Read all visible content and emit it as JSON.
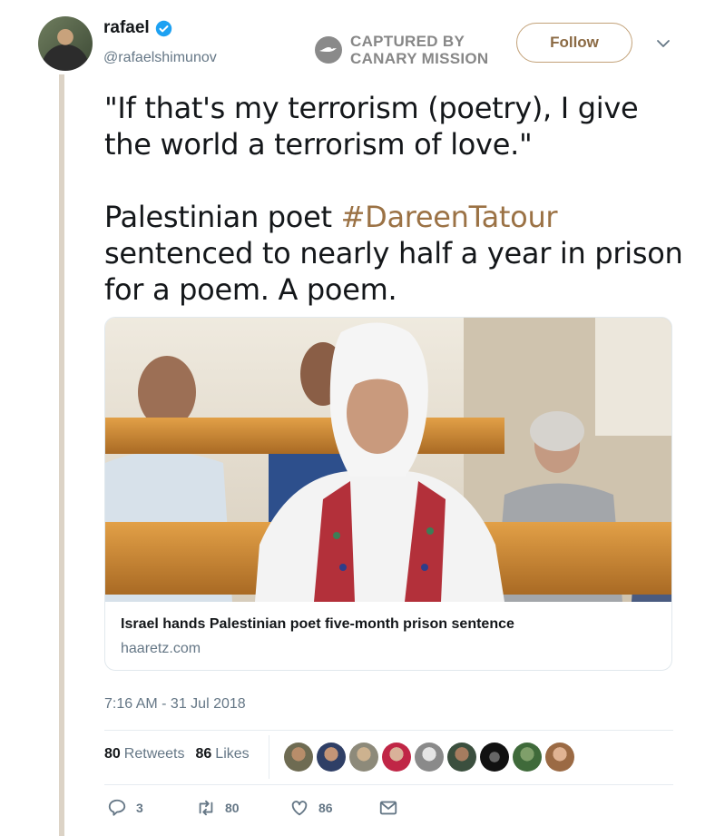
{
  "user": {
    "display_name": "rafael",
    "handle": "@rafaelshimunov",
    "verified": true
  },
  "watermark": {
    "line1": "CAPTURED BY",
    "line2": "CANARY MISSION"
  },
  "follow_label": "Follow",
  "tweet": {
    "quote": "\"If that's my terrorism (poetry), I give the world a terrorism of love.\"",
    "line_before_hashtag": "Palestinian poet ",
    "hashtag": "#DareenTatour",
    "line_after_hashtag": "sentenced to nearly half a year in prison for a poem. A poem."
  },
  "card": {
    "title": "Israel hands Palestinian poet five-month prison sentence",
    "domain": "haaretz.com"
  },
  "timestamp": "7:16 AM - 31 Jul 2018",
  "stats": {
    "retweets_count": "80",
    "retweets_label": "Retweets",
    "likes_count": "86",
    "likes_label": "Likes"
  },
  "actions": {
    "replies": "3",
    "retweets": "80",
    "likes": "86"
  },
  "colors": {
    "accent": "#9b7245",
    "muted": "#657786",
    "verified": "#1da1f2"
  }
}
